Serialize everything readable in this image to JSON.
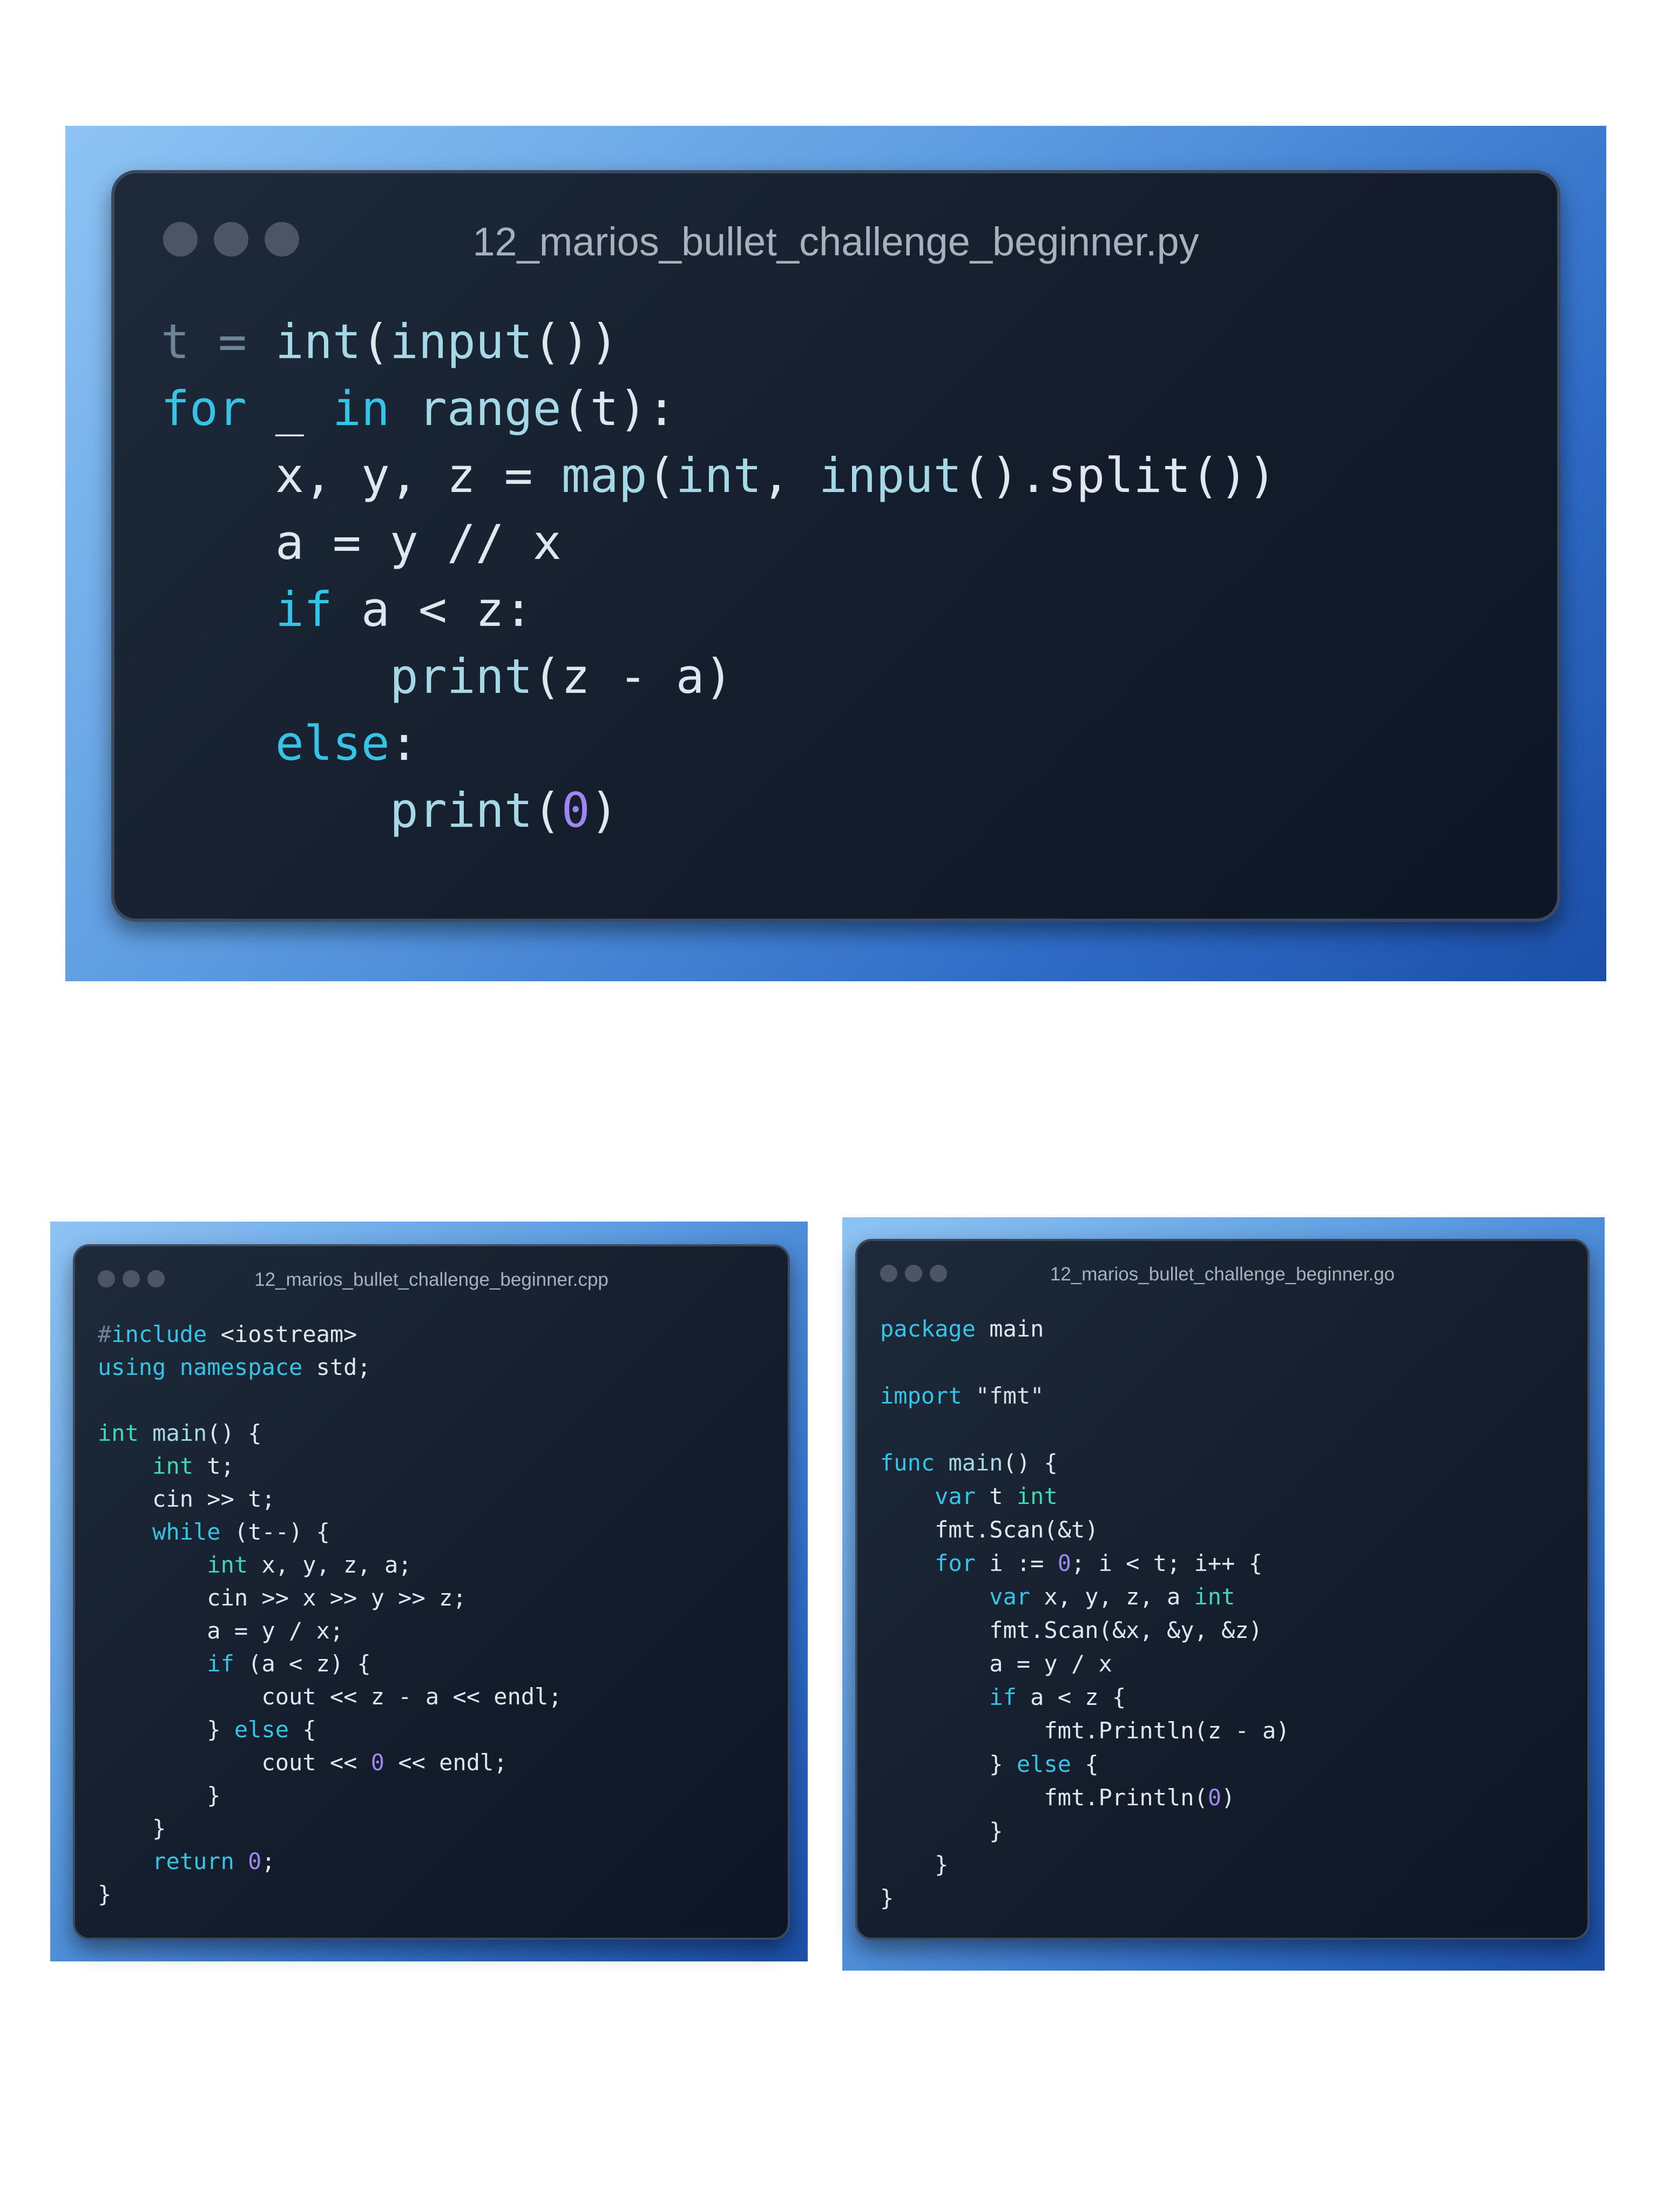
{
  "windows": {
    "python": {
      "filename": "12_marios_bullet_challenge_beginner.py",
      "code": [
        [
          [
            "t = ",
            "p"
          ],
          [
            "int",
            "f"
          ],
          [
            "(",
            ""
          ],
          [
            "input",
            "f"
          ],
          [
            "())",
            ""
          ]
        ],
        [
          [
            "for",
            "k"
          ],
          [
            " _ ",
            ""
          ],
          [
            "in",
            "k"
          ],
          [
            " ",
            ""
          ],
          [
            "range",
            "f"
          ],
          [
            "(t):",
            ""
          ]
        ],
        [
          [
            "    x, y, z = ",
            ""
          ],
          [
            "map",
            "f"
          ],
          [
            "(",
            ""
          ],
          [
            "int",
            "f"
          ],
          [
            ", ",
            ""
          ],
          [
            "input",
            "f"
          ],
          [
            "().split())",
            ""
          ]
        ],
        [
          [
            "    a = y // x",
            ""
          ]
        ],
        [
          [
            "    ",
            ""
          ],
          [
            "if",
            "k"
          ],
          [
            " a < z:",
            ""
          ]
        ],
        [
          [
            "        ",
            ""
          ],
          [
            "print",
            "f"
          ],
          [
            "(z - a)",
            ""
          ]
        ],
        [
          [
            "    ",
            ""
          ],
          [
            "else",
            "k"
          ],
          [
            ":",
            ""
          ]
        ],
        [
          [
            "        ",
            ""
          ],
          [
            "print",
            "f"
          ],
          [
            "(",
            ""
          ],
          [
            "0",
            "n"
          ],
          [
            ")",
            ""
          ]
        ]
      ]
    },
    "cpp": {
      "filename": "12_marios_bullet_challenge_beginner.cpp",
      "code": [
        [
          [
            "#",
            "p"
          ],
          [
            "include",
            "k"
          ],
          [
            " <iostream>",
            ""
          ]
        ],
        [
          [
            "using",
            "k"
          ],
          [
            " ",
            ""
          ],
          [
            "namespace",
            "k"
          ],
          [
            " std;",
            ""
          ]
        ],
        [
          [
            "",
            ""
          ]
        ],
        [
          [
            "int",
            "t"
          ],
          [
            " ",
            ""
          ],
          [
            "main",
            "f"
          ],
          [
            "() {",
            ""
          ]
        ],
        [
          [
            "    ",
            ""
          ],
          [
            "int",
            "t"
          ],
          [
            " t;",
            ""
          ]
        ],
        [
          [
            "    cin >> t;",
            ""
          ]
        ],
        [
          [
            "    ",
            ""
          ],
          [
            "while",
            "k"
          ],
          [
            " (t--) {",
            ""
          ]
        ],
        [
          [
            "        ",
            ""
          ],
          [
            "int",
            "t"
          ],
          [
            " x, y, z, a;",
            ""
          ]
        ],
        [
          [
            "        cin >> x >> y >> z;",
            ""
          ]
        ],
        [
          [
            "        a = y / x;",
            ""
          ]
        ],
        [
          [
            "        ",
            ""
          ],
          [
            "if",
            "k"
          ],
          [
            " (a < z) {",
            ""
          ]
        ],
        [
          [
            "            cout << z - a << endl;",
            ""
          ]
        ],
        [
          [
            "        } ",
            ""
          ],
          [
            "else",
            "k"
          ],
          [
            " {",
            ""
          ]
        ],
        [
          [
            "            cout << ",
            ""
          ],
          [
            "0",
            "n"
          ],
          [
            " << endl;",
            ""
          ]
        ],
        [
          [
            "        }",
            ""
          ]
        ],
        [
          [
            "    }",
            ""
          ]
        ],
        [
          [
            "    ",
            ""
          ],
          [
            "return",
            "k"
          ],
          [
            " ",
            ""
          ],
          [
            "0",
            "n"
          ],
          [
            ";",
            ""
          ]
        ],
        [
          [
            "}",
            ""
          ]
        ]
      ]
    },
    "go": {
      "filename": "12_marios_bullet_challenge_beginner.go",
      "code": [
        [
          [
            "package",
            "k"
          ],
          [
            " main",
            ""
          ]
        ],
        [
          [
            "",
            ""
          ]
        ],
        [
          [
            "import",
            "k"
          ],
          [
            " \"fmt\"",
            "s"
          ]
        ],
        [
          [
            "",
            ""
          ]
        ],
        [
          [
            "func",
            "k"
          ],
          [
            " ",
            ""
          ],
          [
            "main",
            "f"
          ],
          [
            "() {",
            ""
          ]
        ],
        [
          [
            "    ",
            ""
          ],
          [
            "var",
            "k"
          ],
          [
            " t ",
            ""
          ],
          [
            "int",
            "t"
          ]
        ],
        [
          [
            "    fmt.Scan(&t)",
            ""
          ]
        ],
        [
          [
            "    ",
            ""
          ],
          [
            "for",
            "k"
          ],
          [
            " i := ",
            ""
          ],
          [
            "0",
            "n"
          ],
          [
            "; i < t; i++ {",
            ""
          ]
        ],
        [
          [
            "        ",
            ""
          ],
          [
            "var",
            "k"
          ],
          [
            " x, y, z, a ",
            ""
          ],
          [
            "int",
            "t"
          ]
        ],
        [
          [
            "        fmt.Scan(&x, &y, &z)",
            ""
          ]
        ],
        [
          [
            "        a = y / x",
            ""
          ]
        ],
        [
          [
            "        ",
            ""
          ],
          [
            "if",
            "k"
          ],
          [
            " a < z {",
            ""
          ]
        ],
        [
          [
            "            fmt.Println(z - a)",
            ""
          ]
        ],
        [
          [
            "        } ",
            ""
          ],
          [
            "else",
            "k"
          ],
          [
            " {",
            ""
          ]
        ],
        [
          [
            "            fmt.Println(",
            ""
          ],
          [
            "0",
            "n"
          ],
          [
            ")",
            ""
          ]
        ],
        [
          [
            "        }",
            ""
          ]
        ],
        [
          [
            "    }",
            ""
          ]
        ],
        [
          [
            "}",
            ""
          ]
        ]
      ]
    }
  }
}
